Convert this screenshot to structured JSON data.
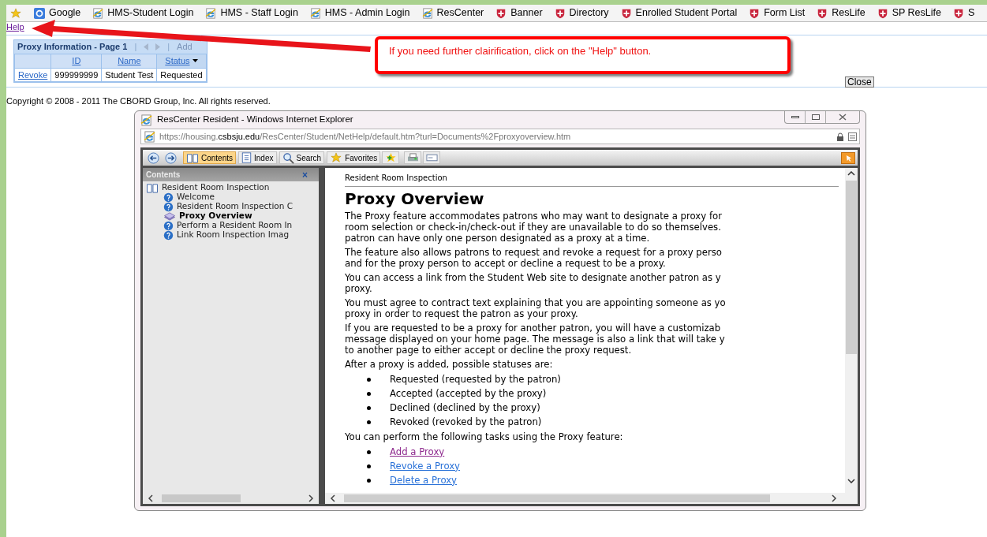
{
  "bookmarks": [
    {
      "kind": "favorites"
    },
    {
      "kind": "google",
      "label": "Google"
    },
    {
      "kind": "ie",
      "label": "HMS-Student Login"
    },
    {
      "kind": "ie",
      "label": "HMS - Staff Login"
    },
    {
      "kind": "ie",
      "label": "HMS - Admin Login"
    },
    {
      "kind": "ie",
      "label": "ResCenter"
    },
    {
      "kind": "shield",
      "label": "Banner"
    },
    {
      "kind": "shield",
      "label": "Directory"
    },
    {
      "kind": "shield",
      "label": "Enrolled Student Portal"
    },
    {
      "kind": "shield",
      "label": "Form List"
    },
    {
      "kind": "shield",
      "label": "ResLife"
    },
    {
      "kind": "shield",
      "label": "SP ResLife"
    },
    {
      "kind": "shield",
      "label": "S"
    }
  ],
  "help_link": "Help",
  "proxy_table": {
    "title": "Proxy Information - Page 1",
    "separator": "|",
    "add": "Add",
    "columns": [
      {
        "sorted": false
      },
      {
        "label": "ID",
        "sorted": false
      },
      {
        "label": "Name",
        "sorted": false
      },
      {
        "label": "Status",
        "sorted": true
      }
    ],
    "rows": [
      [
        "Revoke",
        "999999999",
        "Student Test",
        "Requested"
      ]
    ]
  },
  "callout": "If you need further clairification, click on the \"Help\" button.",
  "close_button": "Close",
  "copyright": "Copyright © 2008 - 2011 The CBORD Group, Inc. All rights reserved.",
  "popup": {
    "title": "ResCenter Resident - Windows Internet Explorer",
    "url": {
      "prefix": "https://housing.",
      "domain": "csbsju.edu",
      "path": "/ResCenter/Student/NetHelp/default.htm?turl=Documents%2Fproxyoverview.htm"
    },
    "toolbar": [
      {
        "kind": "contents",
        "label": "Contents",
        "selected": true
      },
      {
        "kind": "index",
        "label": "Index",
        "selected": false
      },
      {
        "kind": "search",
        "label": "Search",
        "selected": false
      },
      {
        "kind": "favorites",
        "label": "Favorites",
        "selected": false
      }
    ],
    "sidebar": {
      "title": "Contents",
      "close": "×",
      "tree": [
        {
          "label": "Resident Room Inspection",
          "expanded": true,
          "children": [
            {
              "label": "Welcome",
              "selected": false
            },
            {
              "label": "Resident Room Inspection C",
              "selected": false
            },
            {
              "label": "Proxy Overview",
              "selected": true
            },
            {
              "label": "Perform a Resident Room In",
              "selected": false
            },
            {
              "label": "Link Room Inspection Imag",
              "selected": false
            }
          ]
        }
      ]
    },
    "content": {
      "breadcrumb": "Resident Room Inspection",
      "heading": "Proxy Overview",
      "blocks": [
        {
          "kind": "paragraph",
          "lines": [
            "The Proxy feature accommodates patrons who may want to designate a proxy for",
            "room selection or check-in/check-out if they are unavailable to do so themselves.",
            "patron can have only one person designated as a proxy at a time."
          ]
        },
        {
          "kind": "paragraph",
          "lines": [
            "The feature also allows patrons to request and revoke a request for a proxy perso",
            "and for the proxy person to accept or decline a request to be a proxy."
          ]
        },
        {
          "kind": "paragraph",
          "lines": [
            "You can access a link from the Student Web site to designate another patron as y",
            "proxy."
          ]
        },
        {
          "kind": "paragraph",
          "lines": [
            "You must agree to contract text explaining that you are appointing someone as yo",
            "proxy in order to request the patron as your proxy."
          ]
        },
        {
          "kind": "paragraph",
          "lines": [
            "If you are requested to be a proxy for another patron, you will have a customizab",
            "message displayed on your home page. The message is also a link that will take y",
            "to another page to either accept or decline the proxy request."
          ]
        },
        {
          "kind": "paragraph",
          "lines": [
            "After a proxy is added, possible statuses are:"
          ]
        },
        {
          "kind": "bullets",
          "items": [
            {
              "label": "Requested (requested by the patron)"
            },
            {
              "label": "Accepted (accepted by the proxy)"
            },
            {
              "label": "Declined (declined by the proxy)"
            },
            {
              "label": "Revoked (revoked by the patron)"
            }
          ]
        },
        {
          "kind": "paragraph",
          "lines": [
            "You can perform the following tasks using the Proxy feature:"
          ]
        },
        {
          "kind": "links",
          "items": [
            {
              "label": "Add a Proxy",
              "visited": true
            },
            {
              "label": "Revoke a Proxy",
              "visited": false
            },
            {
              "label": "Delete a Proxy",
              "visited": false
            }
          ]
        }
      ]
    }
  }
}
